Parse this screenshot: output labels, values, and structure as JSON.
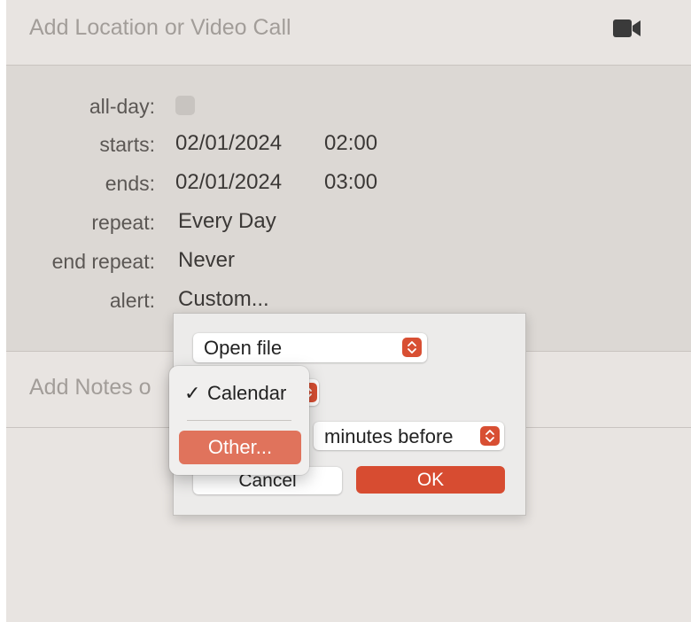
{
  "location": {
    "placeholder": "Add Location or Video Call"
  },
  "icons": {
    "video": "video-camera-icon",
    "stepper": "chevron-up-down-icon",
    "check": "checkmark-icon"
  },
  "event": {
    "allday_label": "all-day:",
    "starts_label": "starts:",
    "starts_date": "02/01/2024",
    "starts_time": "02:00",
    "ends_label": "ends:",
    "ends_date": "02/01/2024",
    "ends_time": "03:00",
    "repeat_label": "repeat:",
    "repeat_value": "Every Day",
    "end_repeat_label": "end repeat:",
    "end_repeat_value": "Never",
    "alert_label": "alert:",
    "alert_value": "Custom..."
  },
  "notes": {
    "placeholder": "Add Notes o"
  },
  "dialog": {
    "action_value": "Open file",
    "unit_value": "minutes before",
    "cancel_label": "Cancel",
    "ok_label": "OK"
  },
  "menu": {
    "checkmark": "✓",
    "item_calendar": "Calendar",
    "item_other": "Other..."
  },
  "colors": {
    "accent": "#d74c31",
    "menu_highlight": "#e0735c",
    "background": "#e8e4e1"
  }
}
